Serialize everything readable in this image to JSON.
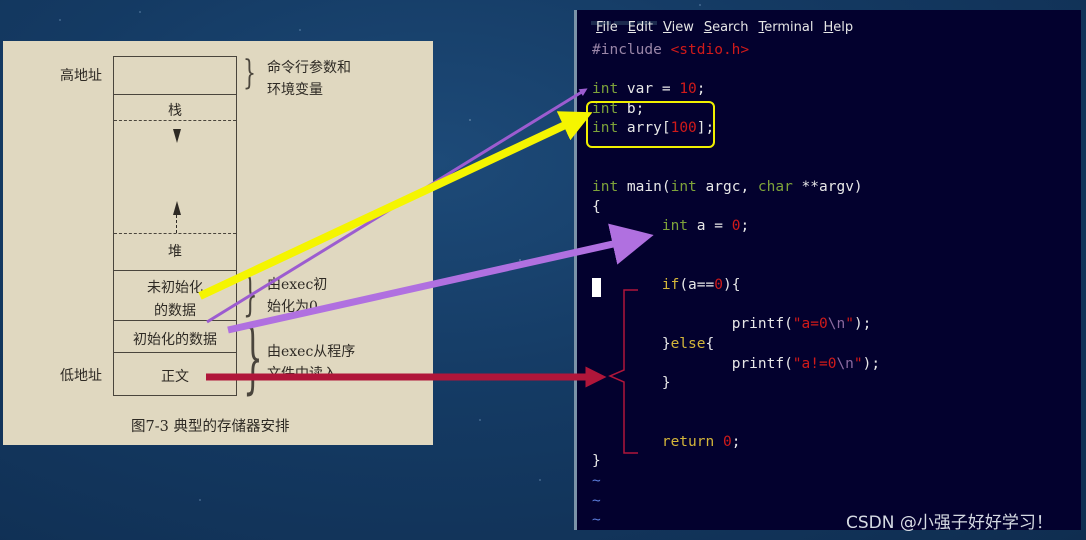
{
  "figure": {
    "high_address": "高地址",
    "low_address": "低地址",
    "segments": {
      "stack": "栈",
      "heap": "堆",
      "bss_line1": "未初始化",
      "bss_line2": "的数据",
      "data": "初始化的数据",
      "text": "正文"
    },
    "annotations": {
      "args_line1": "命令行参数和",
      "args_line2": "环境变量",
      "bss_line1": "由exec初",
      "bss_line2": "始化为0",
      "exec_line1": "由exec从程序",
      "exec_line2": "文件中读入"
    },
    "caption": "图7-3   典型的存储器安排"
  },
  "terminal": {
    "menu": [
      {
        "key": "F",
        "rest": "ile"
      },
      {
        "key": "E",
        "rest": "dit"
      },
      {
        "key": "V",
        "rest": "iew"
      },
      {
        "key": "S",
        "rest": "earch"
      },
      {
        "key": "T",
        "rest": "erminal"
      },
      {
        "key": "H",
        "rest": "elp"
      }
    ],
    "code": {
      "include_kw": "#include",
      "include_file": "<stdio.h>",
      "var_decl_type": "int",
      "var_decl_rest": " var = ",
      "var_decl_val": "10",
      "b_decl_type": "int",
      "b_decl_rest": " b;",
      "arr_type": "int",
      "arr_rest": " arry[",
      "arr_size": "100",
      "arr_end": "];",
      "main_type": "int",
      "main_name": " main(",
      "param1_type": "int",
      "param1_rest": " argc, ",
      "param2_type": "char",
      "param2_rest": " **argv)",
      "open_brace": "{",
      "a_type": "int",
      "a_rest": " a = ",
      "a_val": "0",
      "semi": ";",
      "if_kw": "if",
      "if_cond_open": "(a==",
      "if_cond_val": "0",
      "if_cond_close": "){",
      "printf1_fn": "printf(",
      "printf1_q1": "\"",
      "printf1_text": "a=0",
      "printf1_esc": "\\n",
      "printf1_q2": "\"",
      "printf1_end": ");",
      "else_open": "}",
      "else_kw": "else",
      "else_brace": "{",
      "printf2_fn": "printf(",
      "printf2_q1": "\"",
      "printf2_text": "a!=0",
      "printf2_esc": "\\n",
      "printf2_q2": "\"",
      "printf2_end": ");",
      "close_if": "}",
      "return_kw": "return",
      "return_val": "0",
      "return_semi": ";",
      "close_main": "}",
      "tilde": "~"
    }
  },
  "arrows": [
    {
      "from": "bss",
      "to": "int b; int arry[100];",
      "color": "#f5f500"
    },
    {
      "from": "data",
      "to": "int var = 10;",
      "color": "#b070e0"
    },
    {
      "from": "data",
      "to": "int a = 0;",
      "color": "#b070e0"
    },
    {
      "from": "text",
      "to": "main function body",
      "color": "#b0163a"
    }
  ],
  "watermark": "CSDN @小强子好好学习！"
}
